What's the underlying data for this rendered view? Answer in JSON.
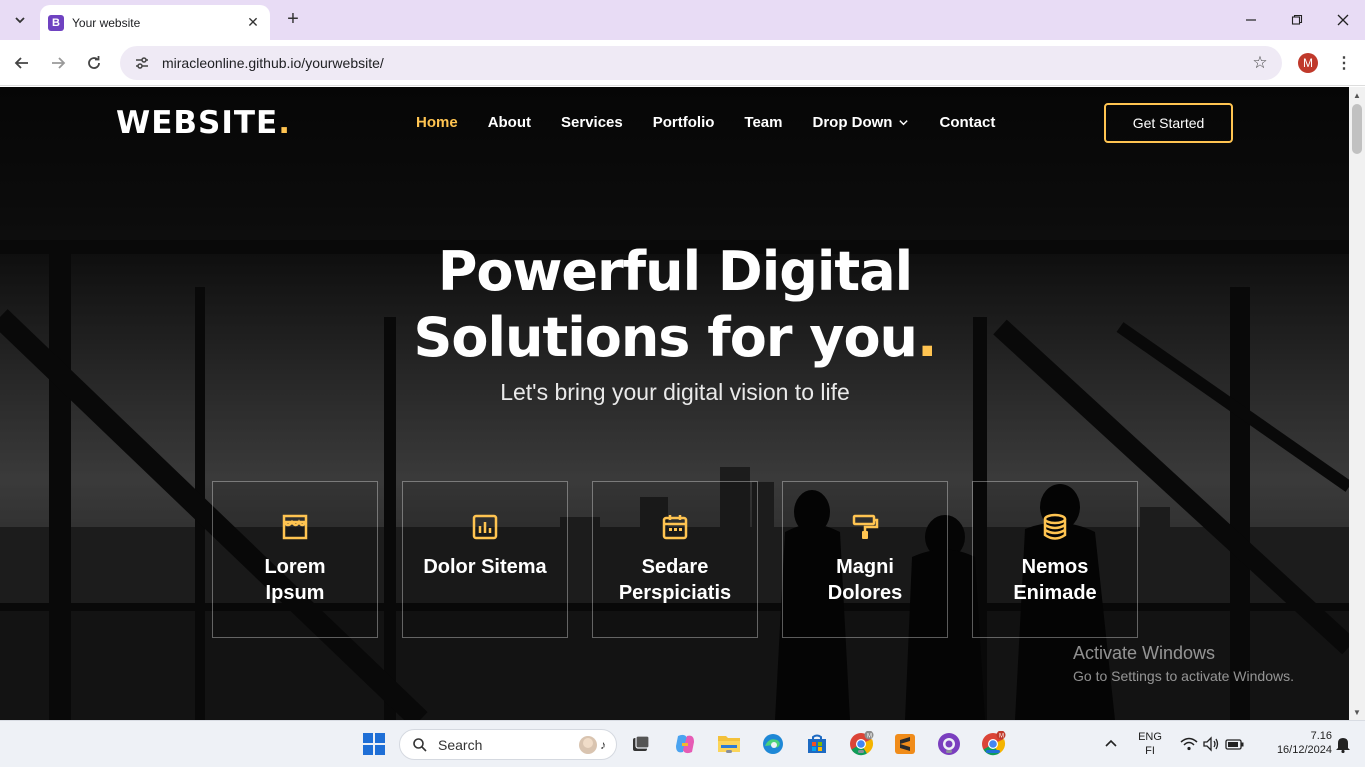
{
  "browser": {
    "tab_title": "Your website",
    "favicon_letter": "B",
    "url": "miracleonline.github.io/yourwebsite/",
    "profile_initial": "M"
  },
  "site": {
    "logo": "WEBSITE",
    "logo_dot": ".",
    "nav": [
      {
        "label": "Home"
      },
      {
        "label": "About"
      },
      {
        "label": "Services"
      },
      {
        "label": "Portfolio"
      },
      {
        "label": "Team"
      },
      {
        "label": "Drop Down"
      },
      {
        "label": "Contact"
      }
    ],
    "cta": "Get Started",
    "accent_color": "#ffc451"
  },
  "hero": {
    "title_line1": "Powerful Digital",
    "title_line2": "Solutions for you",
    "title_dot": ".",
    "subtitle": "Let's bring your digital vision to life"
  },
  "features": [
    {
      "icon": "store-icon",
      "line1": "Lorem",
      "line2": "Ipsum"
    },
    {
      "icon": "bar-chart-icon",
      "line1": "Dolor Sitema",
      "line2": ""
    },
    {
      "icon": "calendar-icon",
      "line1": "Sedare",
      "line2": "Perspiciatis"
    },
    {
      "icon": "paint-roller-icon",
      "line1": "Magni",
      "line2": "Dolores"
    },
    {
      "icon": "database-icon",
      "line1": "Nemos",
      "line2": "Enimade"
    }
  ],
  "watermark": {
    "title": "Activate Windows",
    "subtitle": "Go to Settings to activate Windows."
  },
  "taskbar": {
    "search_label": "Search",
    "lang": "ENG",
    "region": "FI",
    "time": "7.16",
    "date": "16/12/2024"
  }
}
